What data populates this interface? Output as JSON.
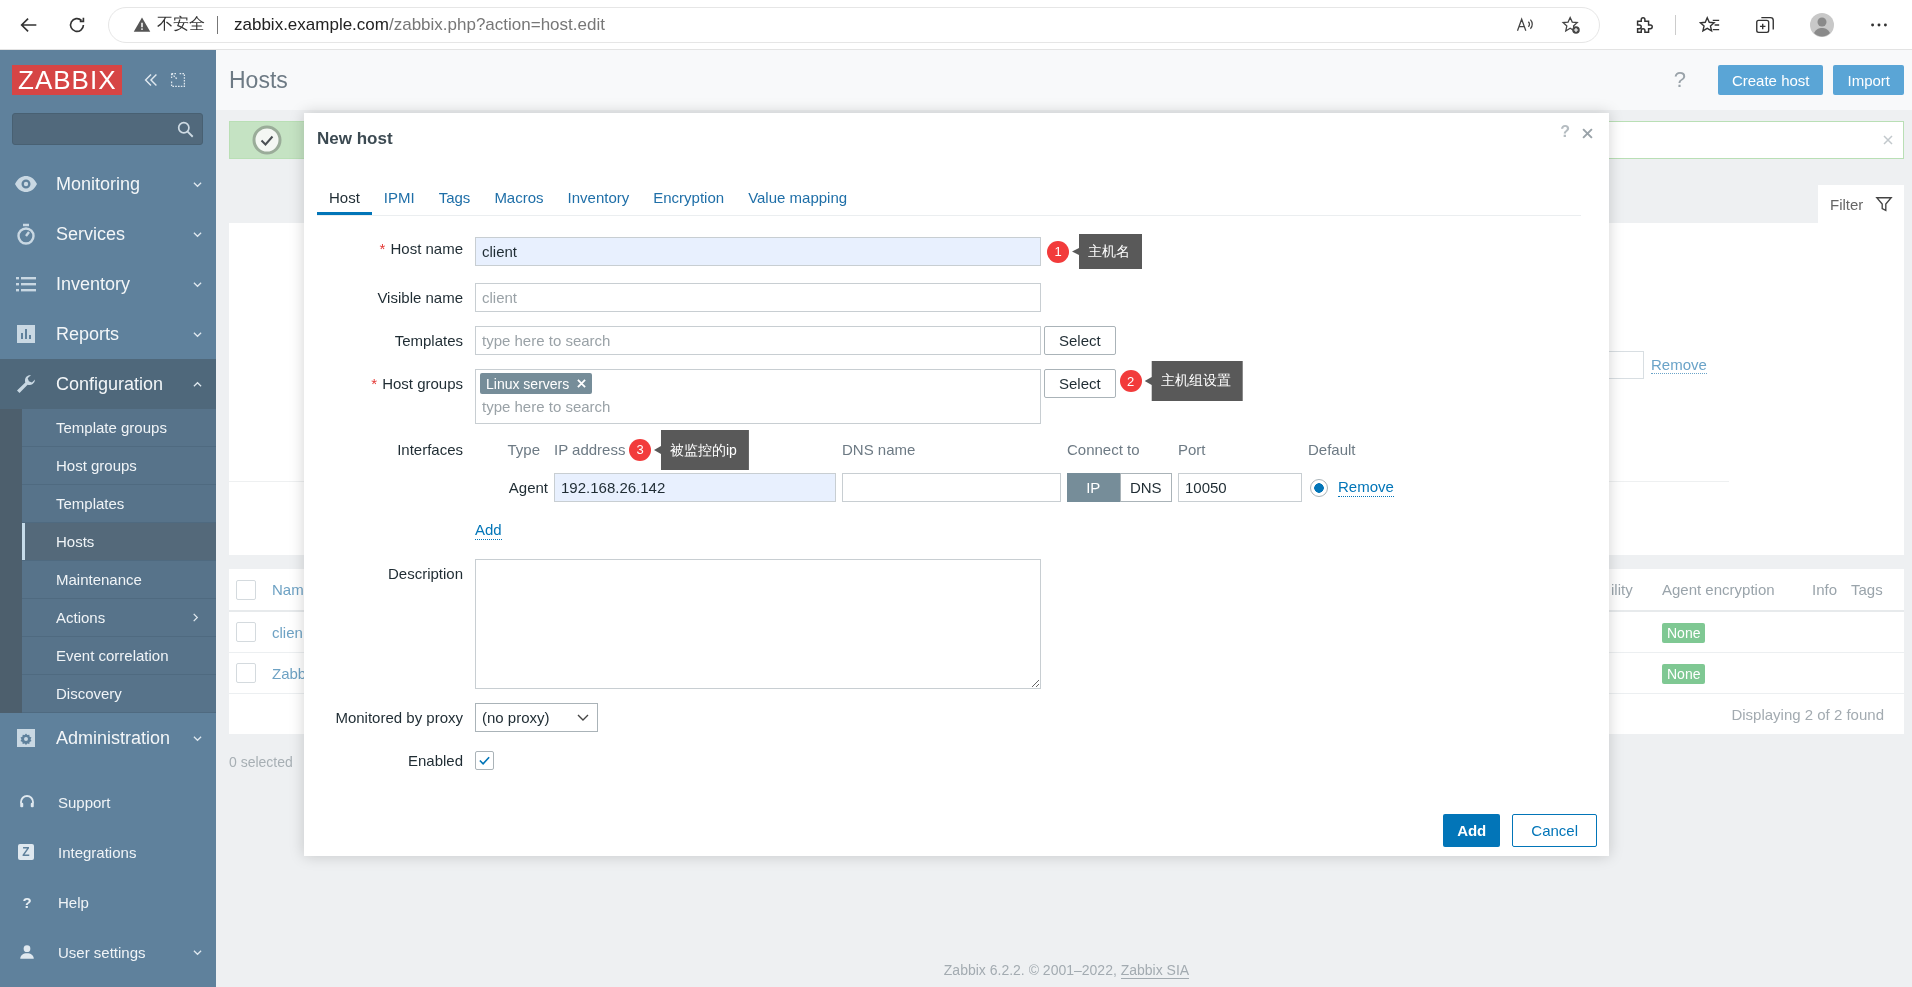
{
  "browser": {
    "security": "不安全",
    "url_host": "zabbix.example.com",
    "url_path": "/zabbix.php?action=host.edit"
  },
  "sidebar": {
    "logo": "ZABBIX",
    "menu": [
      {
        "label": "Monitoring",
        "expanded": false
      },
      {
        "label": "Services",
        "expanded": false
      },
      {
        "label": "Inventory",
        "expanded": false
      },
      {
        "label": "Reports",
        "expanded": false
      },
      {
        "label": "Configuration",
        "expanded": true,
        "children": [
          {
            "label": "Template groups",
            "selected": false,
            "submenu": false
          },
          {
            "label": "Host groups",
            "selected": false,
            "submenu": false
          },
          {
            "label": "Templates",
            "selected": false,
            "submenu": false
          },
          {
            "label": "Hosts",
            "selected": true,
            "submenu": false
          },
          {
            "label": "Maintenance",
            "selected": false,
            "submenu": false
          },
          {
            "label": "Actions",
            "selected": false,
            "submenu": true
          },
          {
            "label": "Event correlation",
            "selected": false,
            "submenu": false
          },
          {
            "label": "Discovery",
            "selected": false,
            "submenu": false
          }
        ]
      },
      {
        "label": "Administration",
        "expanded": false
      }
    ],
    "links": [
      {
        "label": "Support",
        "expandable": false
      },
      {
        "label": "Integrations",
        "expandable": false,
        "icon_text": "Z"
      },
      {
        "label": "Help",
        "expandable": false,
        "icon_text": "?"
      },
      {
        "label": "User settings",
        "expandable": true
      }
    ]
  },
  "page": {
    "title": "Hosts",
    "help": "?",
    "buttons": [
      "Create host",
      "Import"
    ]
  },
  "filter": {
    "tab": "Filter",
    "remove_link": "Remove"
  },
  "table": {
    "columns": [
      "Nam",
      "ility",
      "Agent encryption",
      "Info",
      "Tags"
    ],
    "all_selected": false,
    "rows": [
      {
        "name": "clien",
        "encryption": "None",
        "selected": false
      },
      {
        "name": "Zabb",
        "encryption": "None",
        "selected": false
      }
    ],
    "footer": "Displaying 2 of 2 found"
  },
  "selection": "0 selected",
  "footer": {
    "text": "Zabbix 6.2.2. © 2001–2022, ",
    "link": "Zabbix SIA"
  },
  "dialog": {
    "title": "New host",
    "help": "?",
    "required_mark": "*",
    "tabs": [
      {
        "label": "Host",
        "selected": true
      },
      {
        "label": "IPMI",
        "selected": false
      },
      {
        "label": "Tags",
        "selected": false
      },
      {
        "label": "Macros",
        "selected": false
      },
      {
        "label": "Inventory",
        "selected": false
      },
      {
        "label": "Encryption",
        "selected": false
      },
      {
        "label": "Value mapping",
        "selected": false
      }
    ],
    "host_name": {
      "label": "Host name",
      "required": true,
      "value": "client"
    },
    "visible_name": {
      "label": "Visible name",
      "required": false,
      "placeholder": "client"
    },
    "templates": {
      "label": "Templates",
      "required": false,
      "placeholder": "type here to search",
      "button": "Select"
    },
    "host_groups": {
      "label": "Host groups",
      "required": true,
      "tags": [
        "Linux servers"
      ],
      "placeholder": "type here to search",
      "button": "Select"
    },
    "interfaces": {
      "label": "Interfaces",
      "columns": [
        "Type",
        "IP address",
        "DNS name",
        "Connect to",
        "Port",
        "Default"
      ],
      "rows": [
        {
          "type": "Agent",
          "ip": "192.168.26.142",
          "connect": [
            {
              "label": "IP",
              "selected": true
            },
            {
              "label": "DNS",
              "selected": false
            }
          ],
          "port": "10050",
          "default": true,
          "remove": "Remove"
        }
      ],
      "add": "Add"
    },
    "description": {
      "label": "Description"
    },
    "proxy": {
      "label": "Monitored by proxy",
      "value": "(no proxy)"
    },
    "enabled": {
      "label": "Enabled",
      "checked": true
    },
    "buttons": {
      "primary": "Add",
      "secondary": "Cancel"
    },
    "annotations": [
      {
        "number": "1",
        "text": "主机名"
      },
      {
        "number": "2",
        "text": "主机组设置"
      },
      {
        "number": "3",
        "text": "被监控的ip"
      }
    ]
  }
}
